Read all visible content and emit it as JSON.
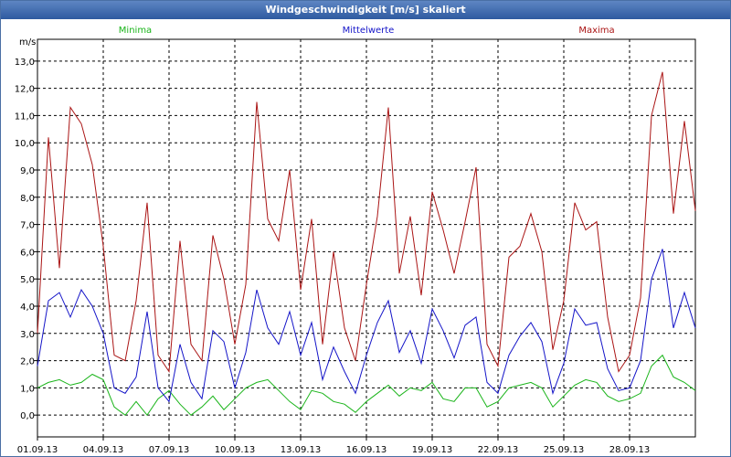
{
  "window": {
    "title": "Windgeschwindigkeit [m/s] skaliert"
  },
  "chart_data": {
    "type": "line",
    "ylabel": "m/s",
    "ylim": [
      -0.8,
      13.8
    ],
    "yticks": [
      "0,0",
      "1,0",
      "2,0",
      "3,0",
      "4,0",
      "5,0",
      "6,0",
      "7,0",
      "8,0",
      "9,0",
      "10,0",
      "11,0",
      "12,0",
      "13,0"
    ],
    "xlim": [
      0,
      30
    ],
    "xtick_positions": [
      0,
      3,
      6,
      9,
      12,
      15,
      18,
      21,
      24,
      27
    ],
    "xticks": [
      "01.09.13",
      "04.09.13",
      "07.09.13",
      "10.09.13",
      "13.09.13",
      "16.09.13",
      "19.09.13",
      "22.09.13",
      "25.09.13",
      "28.09.13"
    ],
    "grid": true,
    "legend_position": "top",
    "series": [
      {
        "name": "Minima",
        "color": "#19b419",
        "x": [
          0,
          0.5,
          1,
          1.5,
          2,
          2.5,
          3,
          3.5,
          4,
          4.5,
          5,
          5.5,
          6,
          6.5,
          7,
          7.5,
          8,
          8.5,
          9,
          9.5,
          10,
          10.5,
          11,
          11.5,
          12,
          12.5,
          13,
          13.5,
          14,
          14.5,
          15,
          15.5,
          16,
          16.5,
          17,
          17.5,
          18,
          18.5,
          19,
          19.5,
          20,
          20.5,
          21,
          21.5,
          22,
          22.5,
          23,
          23.5,
          24,
          24.5,
          25,
          25.5,
          26,
          26.5,
          27,
          27.5,
          28,
          28.5,
          29,
          29.5,
          30
        ],
        "values": [
          1.0,
          1.2,
          1.3,
          1.1,
          1.2,
          1.5,
          1.3,
          0.3,
          0.0,
          0.5,
          0.0,
          0.6,
          0.9,
          0.4,
          0.0,
          0.3,
          0.7,
          0.2,
          0.6,
          1.0,
          1.2,
          1.3,
          0.9,
          0.5,
          0.2,
          0.9,
          0.8,
          0.5,
          0.4,
          0.1,
          0.5,
          0.8,
          1.1,
          0.7,
          1.0,
          0.9,
          1.2,
          0.6,
          0.5,
          1.0,
          1.0,
          0.3,
          0.5,
          1.0,
          1.1,
          1.2,
          1.0,
          0.3,
          0.7,
          1.1,
          1.3,
          1.2,
          0.7,
          0.5,
          0.6,
          0.8,
          1.8,
          2.2,
          1.4,
          1.2,
          0.9
        ]
      },
      {
        "name": "Mittelwerte",
        "color": "#1414c8",
        "x": [
          0,
          0.5,
          1,
          1.5,
          2,
          2.5,
          3,
          3.5,
          4,
          4.5,
          5,
          5.5,
          6,
          6.5,
          7,
          7.5,
          8,
          8.5,
          9,
          9.5,
          10,
          10.5,
          11,
          11.5,
          12,
          12.5,
          13,
          13.5,
          14,
          14.5,
          15,
          15.5,
          16,
          16.5,
          17,
          17.5,
          18,
          18.5,
          19,
          19.5,
          20,
          20.5,
          21,
          21.5,
          22,
          22.5,
          23,
          23.5,
          24,
          24.5,
          25,
          25.5,
          26,
          26.5,
          27,
          27.5,
          28,
          28.5,
          29,
          29.5,
          30
        ],
        "values": [
          1.8,
          4.2,
          4.5,
          3.6,
          4.6,
          4.0,
          3.0,
          1.0,
          0.8,
          1.4,
          3.8,
          1.0,
          0.5,
          2.6,
          1.2,
          0.6,
          3.1,
          2.7,
          1.0,
          2.3,
          4.6,
          3.2,
          2.6,
          3.8,
          2.2,
          3.4,
          1.3,
          2.5,
          1.6,
          0.8,
          2.2,
          3.4,
          4.2,
          2.3,
          3.1,
          1.9,
          3.9,
          3.1,
          2.1,
          3.3,
          3.6,
          1.2,
          0.8,
          2.2,
          2.9,
          3.4,
          2.7,
          0.8,
          1.9,
          3.9,
          3.3,
          3.4,
          1.7,
          0.9,
          1.0,
          2.0,
          5.0,
          6.1,
          3.2,
          4.5,
          3.2
        ]
      },
      {
        "name": "Maxima",
        "color": "#aa1414",
        "x": [
          0,
          0.5,
          1,
          1.5,
          2,
          2.5,
          3,
          3.5,
          4,
          4.5,
          5,
          5.5,
          6,
          6.5,
          7,
          7.5,
          8,
          8.5,
          9,
          9.5,
          10,
          10.5,
          11,
          11.5,
          12,
          12.5,
          13,
          13.5,
          14,
          14.5,
          15,
          15.5,
          16,
          16.5,
          17,
          17.5,
          18,
          18.5,
          19,
          19.5,
          20,
          20.5,
          21,
          21.5,
          22,
          22.5,
          23,
          23.5,
          24,
          24.5,
          25,
          25.5,
          26,
          26.5,
          27,
          27.5,
          28,
          28.5,
          29,
          29.5,
          30
        ],
        "values": [
          3.0,
          10.2,
          5.4,
          11.3,
          10.7,
          9.2,
          6.2,
          2.2,
          2.0,
          4.2,
          7.8,
          2.2,
          1.6,
          6.4,
          2.6,
          2.0,
          6.6,
          5.0,
          2.6,
          4.8,
          11.5,
          7.2,
          6.4,
          9.0,
          4.6,
          7.2,
          2.6,
          6.0,
          3.2,
          2.0,
          4.8,
          7.3,
          11.3,
          5.2,
          7.3,
          4.4,
          8.2,
          6.8,
          5.2,
          7.1,
          9.1,
          2.6,
          1.8,
          5.8,
          6.2,
          7.4,
          6.0,
          2.4,
          4.2,
          7.8,
          6.8,
          7.1,
          3.6,
          1.6,
          2.2,
          4.3,
          11.0,
          12.6,
          7.4,
          10.8,
          7.5
        ]
      }
    ]
  }
}
